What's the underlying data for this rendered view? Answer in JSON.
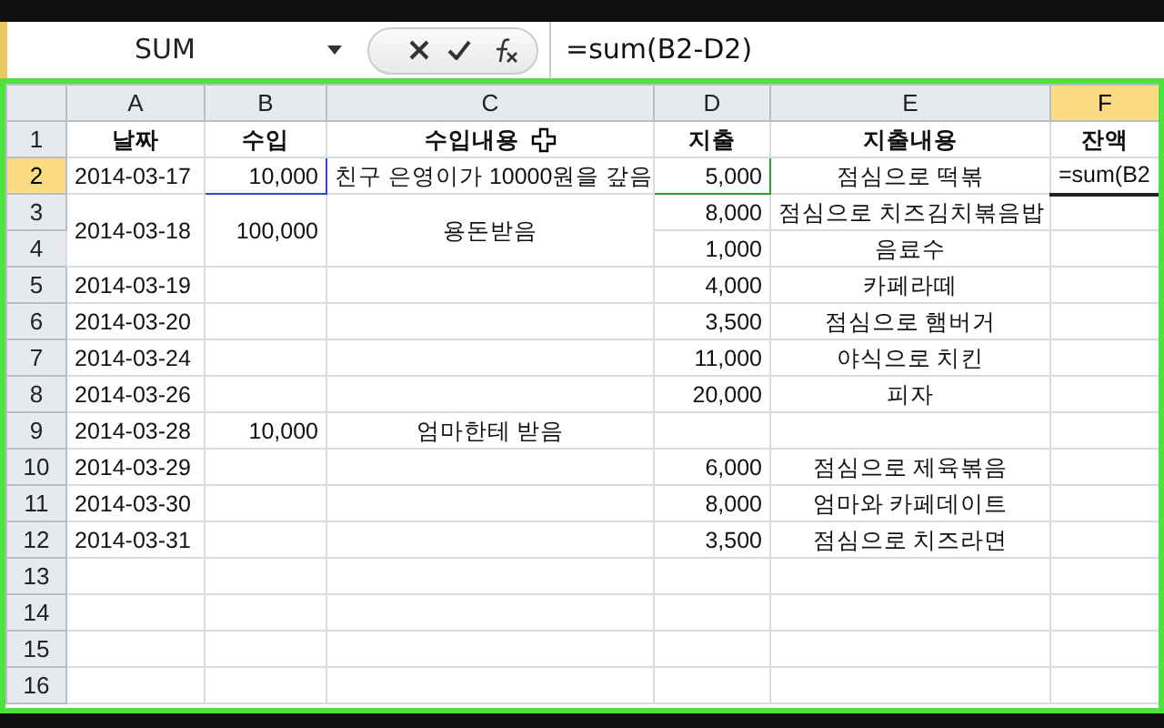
{
  "formula_bar": {
    "name_box": "SUM",
    "formula": "=sum(B2-D2)"
  },
  "columns": [
    {
      "label": "A",
      "selected": false
    },
    {
      "label": "B",
      "selected": false
    },
    {
      "label": "C",
      "selected": false
    },
    {
      "label": "D",
      "selected": false
    },
    {
      "label": "E",
      "selected": false
    },
    {
      "label": "F",
      "selected": true
    }
  ],
  "rows": [
    {
      "number": "1",
      "selected": false,
      "cells": [
        {
          "text": "날짜",
          "kind": "header"
        },
        {
          "text": "수입",
          "kind": "header"
        },
        {
          "text": "수입내용",
          "kind": "header"
        },
        {
          "text": "지출",
          "kind": "header"
        },
        {
          "text": "지출내용",
          "kind": "header"
        },
        {
          "text": "잔액",
          "kind": "header"
        }
      ]
    },
    {
      "number": "2",
      "selected": true,
      "cells": [
        {
          "text": "2014-03-17",
          "kind": "date"
        },
        {
          "text": "10,000",
          "kind": "number",
          "color": "#3348d0"
        },
        {
          "text": "친구 은영이가 10000원을 갚음",
          "kind": "text"
        },
        {
          "text": "5,000",
          "kind": "number",
          "color": "#2e9a3a"
        },
        {
          "text": "점심으로 떡볶",
          "kind": "text"
        },
        {
          "text": "=sum(B2",
          "kind": "editing"
        }
      ]
    },
    {
      "number": "3",
      "selected": false,
      "cells": [
        {
          "text": "2014-03-18",
          "kind": "date",
          "merged_with_next": true
        },
        {
          "text": "100,000",
          "kind": "number",
          "merged_with_next": true
        },
        {
          "text": "용돈받음",
          "kind": "text",
          "merged_with_next": true
        },
        {
          "text": "8,000",
          "kind": "number"
        },
        {
          "text": "점심으로 치즈김치볶음밥",
          "kind": "text"
        },
        null
      ]
    },
    {
      "number": "4",
      "selected": false,
      "cells": [
        null,
        null,
        null,
        {
          "text": "1,000",
          "kind": "number"
        },
        {
          "text": "음료수",
          "kind": "text"
        },
        null
      ]
    },
    {
      "number": "5",
      "selected": false,
      "cells": [
        {
          "text": "2014-03-19",
          "kind": "date"
        },
        null,
        null,
        {
          "text": "4,000",
          "kind": "number"
        },
        {
          "text": "카페라떼",
          "kind": "text"
        },
        null
      ]
    },
    {
      "number": "6",
      "selected": false,
      "cells": [
        {
          "text": "2014-03-20",
          "kind": "date"
        },
        null,
        null,
        {
          "text": "3,500",
          "kind": "number"
        },
        {
          "text": "점심으로 햄버거",
          "kind": "text"
        },
        null
      ]
    },
    {
      "number": "7",
      "selected": false,
      "cells": [
        {
          "text": "2014-03-24",
          "kind": "date"
        },
        null,
        null,
        {
          "text": "11,000",
          "kind": "number"
        },
        {
          "text": "야식으로 치킨",
          "kind": "text"
        },
        null
      ]
    },
    {
      "number": "8",
      "selected": false,
      "cells": [
        {
          "text": "2014-03-26",
          "kind": "date"
        },
        null,
        null,
        {
          "text": "20,000",
          "kind": "number"
        },
        {
          "text": "피자",
          "kind": "text"
        },
        null
      ]
    },
    {
      "number": "9",
      "selected": false,
      "cells": [
        {
          "text": "2014-03-28",
          "kind": "date"
        },
        {
          "text": "10,000",
          "kind": "number"
        },
        {
          "text": "엄마한테 받음",
          "kind": "text"
        },
        null,
        null,
        null
      ]
    },
    {
      "number": "10",
      "selected": false,
      "cells": [
        {
          "text": "2014-03-29",
          "kind": "date"
        },
        null,
        null,
        {
          "text": "6,000",
          "kind": "number"
        },
        {
          "text": "점심으로 제육볶음",
          "kind": "text"
        },
        null
      ]
    },
    {
      "number": "11",
      "selected": false,
      "cells": [
        {
          "text": "2014-03-30",
          "kind": "date"
        },
        null,
        null,
        {
          "text": "8,000",
          "kind": "number"
        },
        {
          "text": "엄마와 카페데이트",
          "kind": "text"
        },
        null
      ]
    },
    {
      "number": "12",
      "selected": false,
      "cells": [
        {
          "text": "2014-03-31",
          "kind": "date"
        },
        null,
        null,
        {
          "text": "3,500",
          "kind": "number"
        },
        {
          "text": "점심으로 치즈라면",
          "kind": "text"
        },
        null
      ]
    },
    {
      "number": "13",
      "selected": false,
      "cells": [
        null,
        null,
        null,
        null,
        null,
        null
      ]
    },
    {
      "number": "14",
      "selected": false,
      "cells": [
        null,
        null,
        null,
        null,
        null,
        null
      ]
    },
    {
      "number": "15",
      "selected": false,
      "cells": [
        null,
        null,
        null,
        null,
        null,
        null
      ]
    },
    {
      "number": "16",
      "selected": false,
      "cells": [
        null,
        null,
        null,
        null,
        null,
        null
      ]
    }
  ]
}
